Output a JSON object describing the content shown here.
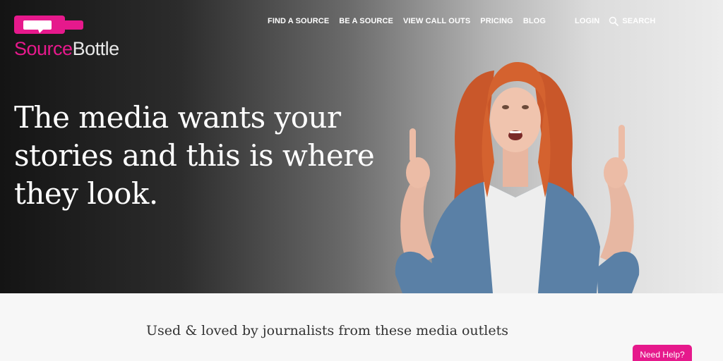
{
  "brand": {
    "name_part1": "Source",
    "name_part2": "Bottle",
    "accent_color": "#e6198c"
  },
  "nav": {
    "items": [
      {
        "label": "FIND A SOURCE"
      },
      {
        "label": "BE A SOURCE"
      },
      {
        "label": "VIEW CALL OUTS"
      },
      {
        "label": "PRICING"
      },
      {
        "label": "BLOG"
      }
    ],
    "login_label": "LOGIN",
    "search_label": "SEARCH",
    "search_icon": "search-icon"
  },
  "hero": {
    "headline": "The media wants your stories and this is where they look."
  },
  "media": {
    "tagline": "Used & loved by journalists from these media outlets"
  },
  "help": {
    "label": "Need Help?"
  }
}
